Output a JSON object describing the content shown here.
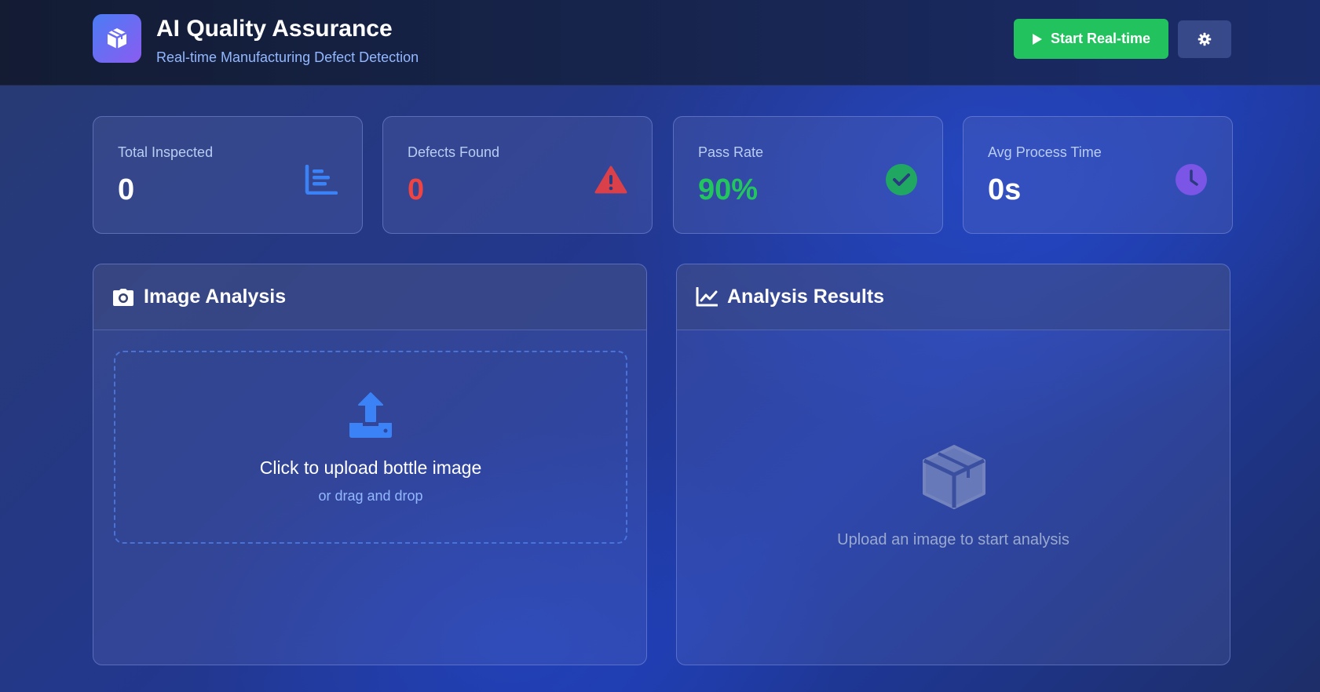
{
  "header": {
    "title": "AI Quality Assurance",
    "subtitle": "Real-time Manufacturing Defect Detection",
    "logo_icon": "cube-icon",
    "start_button": {
      "label": "Start Real-time",
      "icon": "play-icon",
      "color": "#22c35e"
    },
    "settings_button": {
      "icon": "gear-icon"
    }
  },
  "stats": [
    {
      "label": "Total Inspected",
      "value": "0",
      "icon": "bar-chart-icon",
      "value_color": "#ffffff",
      "icon_color": "#3b82f6"
    },
    {
      "label": "Defects Found",
      "value": "0",
      "icon": "warning-icon",
      "value_color": "#ef4444",
      "icon_color": "#ef4444"
    },
    {
      "label": "Pass Rate",
      "value": "90%",
      "icon": "check-circle-icon",
      "value_color": "#22c55e",
      "icon_color": "#22c55e"
    },
    {
      "label": "Avg Process Time",
      "value": "0s",
      "icon": "clock-icon",
      "value_color": "#ffffff",
      "icon_color": "#8b5cf6"
    }
  ],
  "image_analysis": {
    "title": "Image Analysis",
    "icon": "camera-icon",
    "upload": {
      "icon": "upload-icon",
      "title": "Click to upload bottle image",
      "subtitle": "or drag and drop"
    }
  },
  "analysis_results": {
    "title": "Analysis Results",
    "icon": "line-chart-icon",
    "empty_icon": "cube-icon",
    "empty_text": "Upload an image to start analysis"
  },
  "colors": {
    "accent_blue": "#3b82f6",
    "success_green": "#22c55e",
    "danger_red": "#ef4444",
    "purple": "#8b5cf6"
  }
}
